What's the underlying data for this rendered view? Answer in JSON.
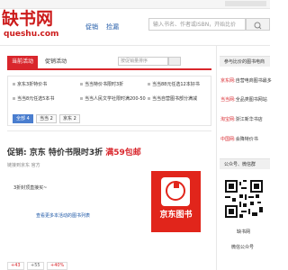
{
  "site": {
    "logo_text": "缺书网",
    "logo_sub": "queshu.com"
  },
  "nav": {
    "items": [
      "促销",
      "捡漏"
    ]
  },
  "search": {
    "placeholder": "输入书名、作者或ISBN，开始比价"
  },
  "tabs": {
    "active": "当前活动",
    "second": "促销活动",
    "sort_placeholder": "按促销量排序"
  },
  "promos": [
    "京东3折特价书",
    "当当特价书限时3折",
    "当当88元任选12本好书",
    "当当8元任选5本书",
    "当当人民文学社限时满200-50",
    "当当自营图书部分满减"
  ],
  "filters": [
    "全部 4",
    "当当 2",
    "京东 2"
  ],
  "deal": {
    "prefix": "促销: 京东 特价书限时3折",
    "highlight": "满59包邮",
    "meta": "链接到京东    官方",
    "desc": "3折封顶直接买~",
    "link": "查看更多本活动的图书列表"
  },
  "brand": {
    "jd_name": "京东图书"
  },
  "votes": [
    "+43",
    "+55",
    "+40%"
  ],
  "sidebar": {
    "compare_title": "参与比价的图书电商",
    "stores": [
      {
        "name": "京东网:",
        "desc": "自营电商图书最多"
      },
      {
        "name": "当当网:",
        "desc": "全品类图书网站"
      },
      {
        "name": "淘宝网:",
        "desc": "浙江新华书店"
      },
      {
        "name": "中国网:",
        "desc": "会降特价书"
      }
    ],
    "wechat_title": "公众号、微信群",
    "qr_caption": "缺书网",
    "qr_sub": "微信公众号"
  },
  "colors": {
    "brand_red": "#cc1b1b",
    "accent_red": "#d9262c",
    "link_blue": "#1a55a5",
    "jd_red": "#e1251b"
  }
}
